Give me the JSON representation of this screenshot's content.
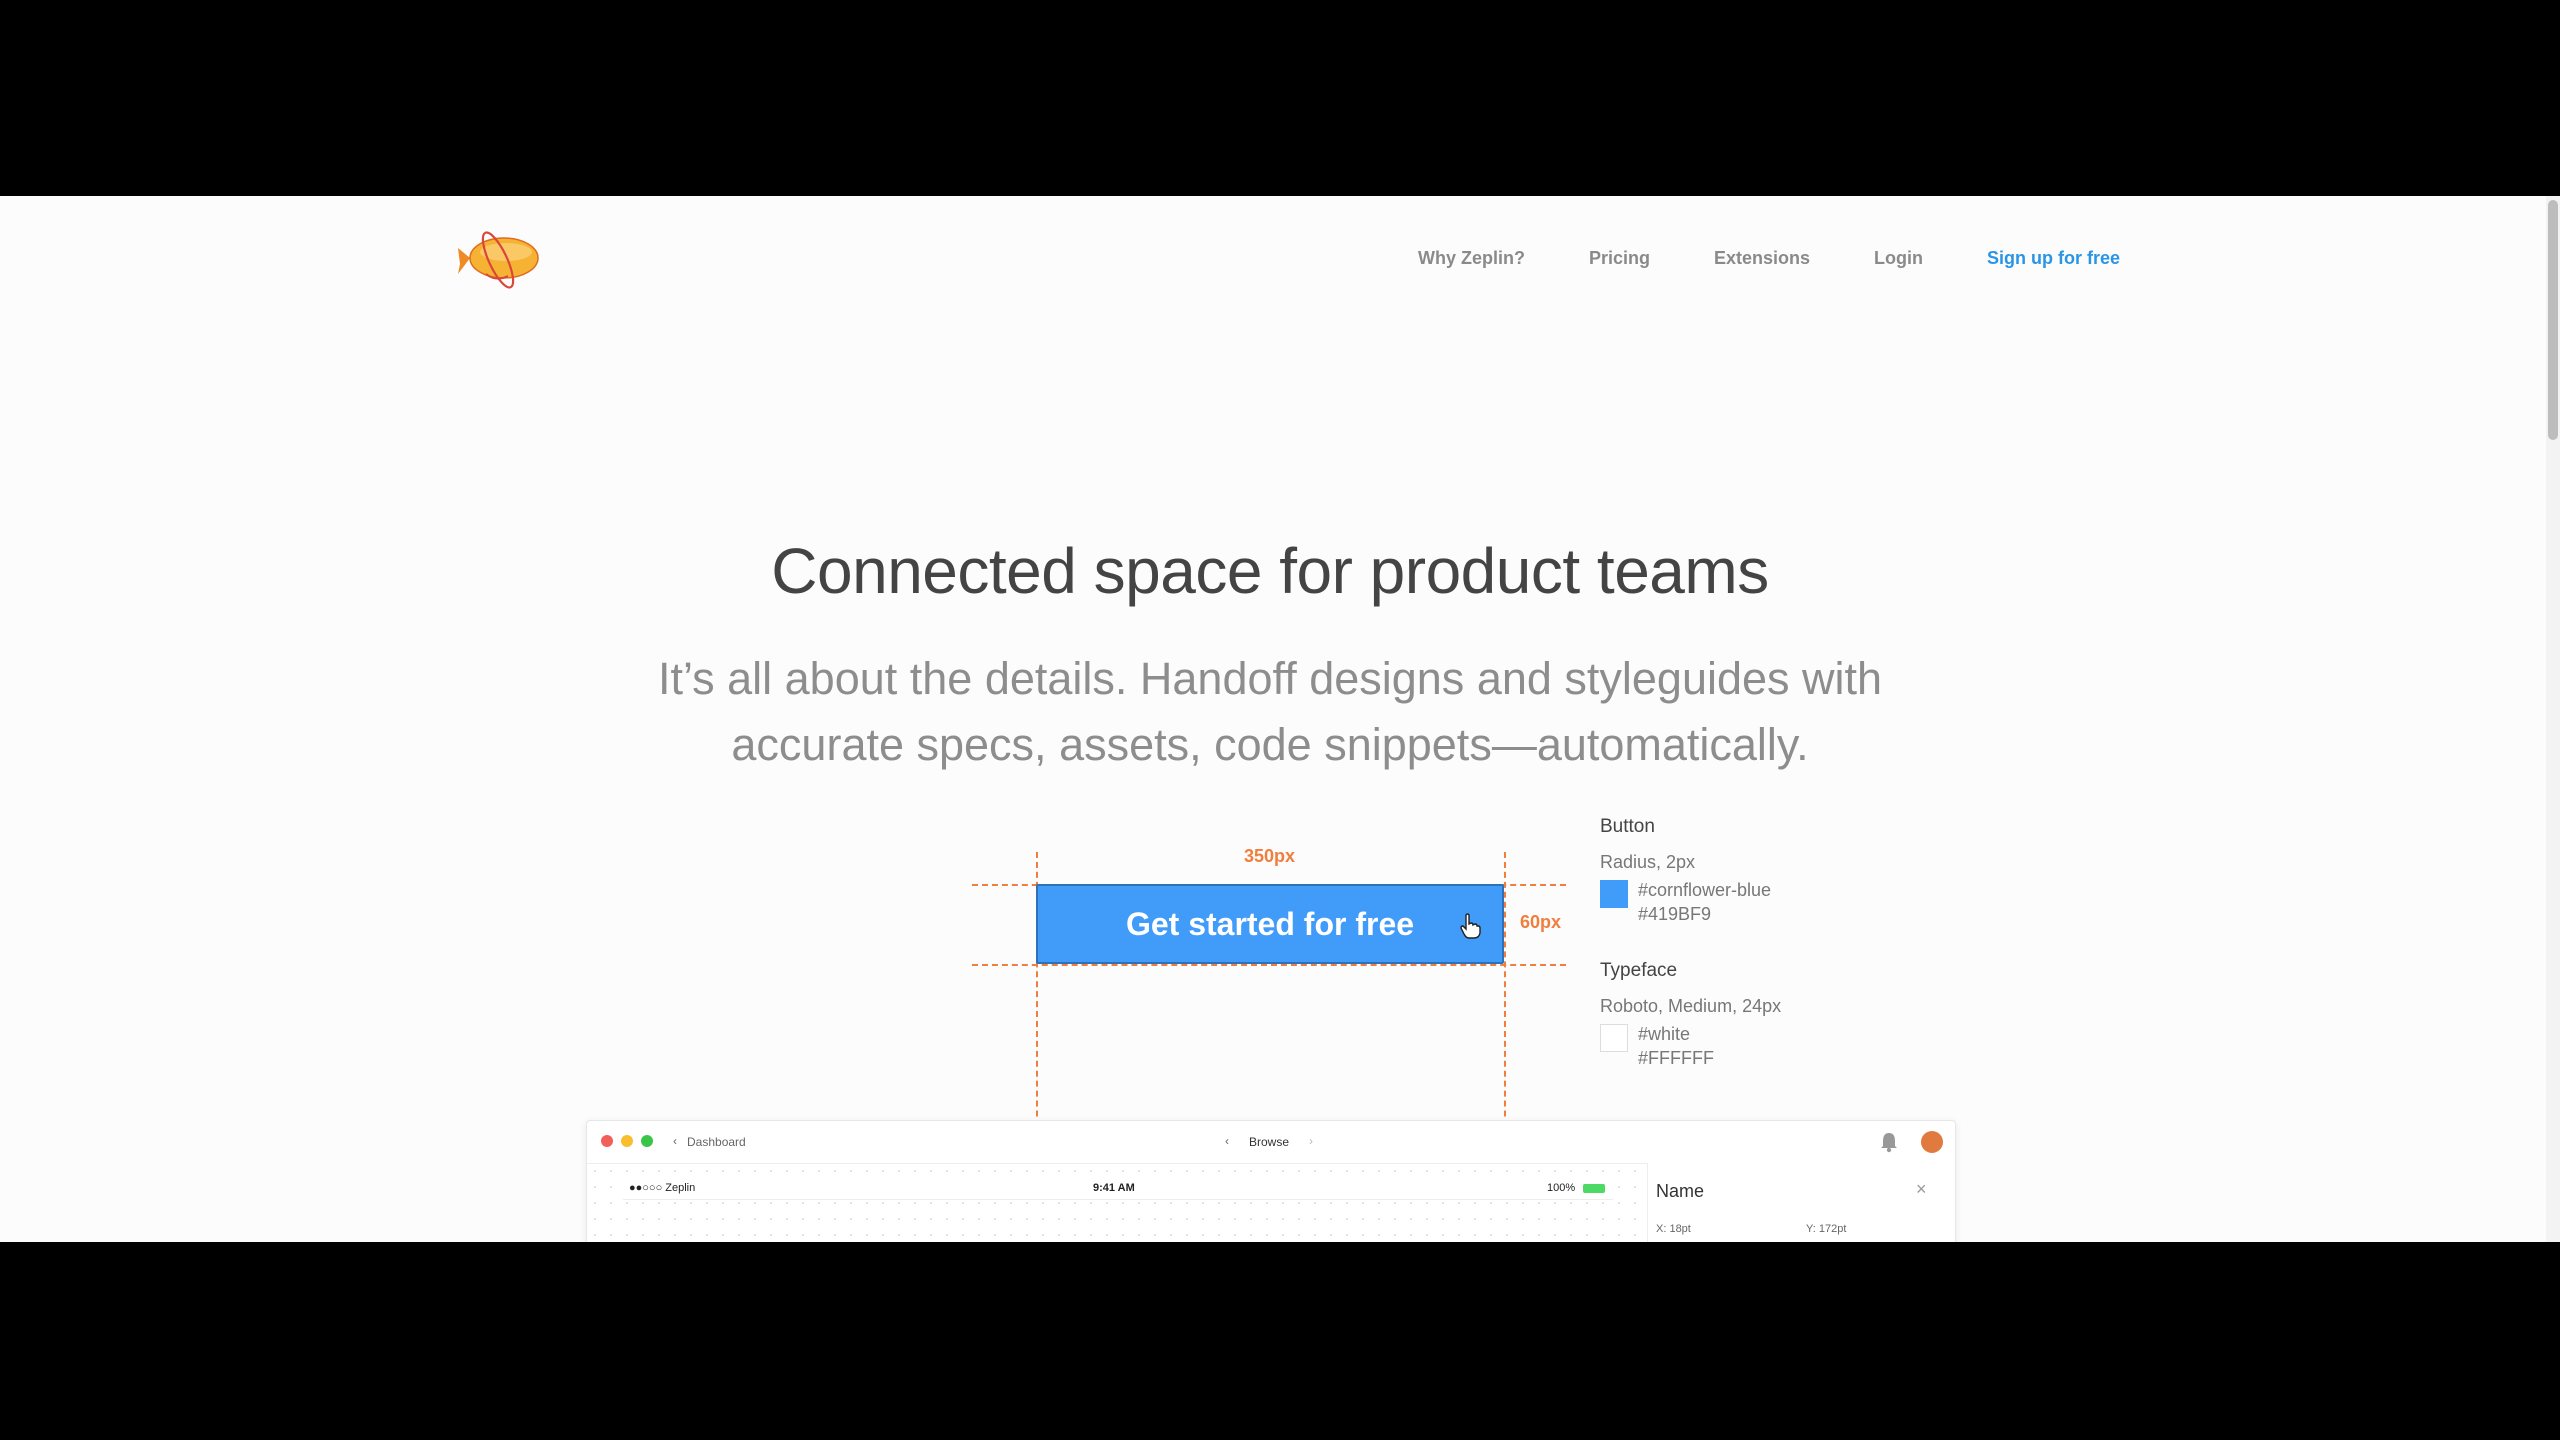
{
  "nav": {
    "items": [
      "Why Zeplin?",
      "Pricing",
      "Extensions",
      "Login"
    ],
    "signup": "Sign up for free"
  },
  "hero": {
    "title": "Connected space for product teams",
    "subtitle_line1": "It’s all about the details. Handoff designs and styleguides with",
    "subtitle_line2": "accurate specs, assets, code snippets—automatically."
  },
  "demo": {
    "cta_label": "Get started for free",
    "width_label": "350px",
    "height_label": "60px"
  },
  "spec": {
    "button_heading": "Button",
    "radius": "Radius, 2px",
    "color_name": "#cornflower-blue",
    "color_hex": "#419BF9",
    "typeface_heading": "Typeface",
    "typeface": "Roboto, Medium, 24px",
    "text_color_name": "#white",
    "text_color_hex": "#FFFFFF"
  },
  "colors": {
    "accent": "#2a95e6",
    "button": "#419BF9",
    "guide": "#f07e3d"
  },
  "app_preview": {
    "back_label": "Dashboard",
    "center_label": "Browse",
    "carrier": "●●○○○ Zeplin",
    "time": "9:41 AM",
    "battery": "100%",
    "panel_title": "Name",
    "x_label": "X: 18pt",
    "y_label": "Y: 172pt"
  }
}
